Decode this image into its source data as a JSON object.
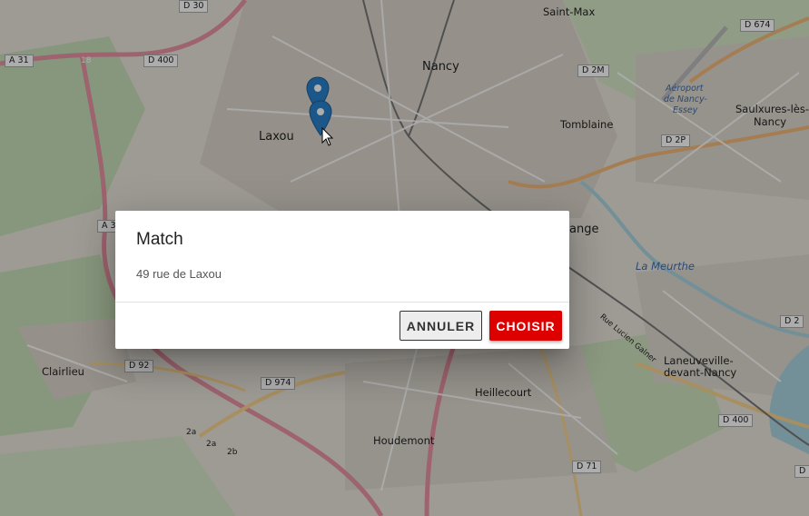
{
  "map": {
    "places": [
      "Saint-Max",
      "Nancy",
      "Laxou",
      "Tomblaine",
      "Aéroport",
      "de Nancy-",
      "Essey",
      "Saulxures-lès-",
      "Nancy",
      "ange",
      "La Meurthe",
      "Clairlieu",
      "Heillecourt",
      "Houdemont",
      "Laneuveville-",
      "devant-Nancy",
      "Rue Lucien Galner"
    ],
    "roads": [
      "D 30",
      "D 674",
      "A 31",
      "D 400",
      "D 2M",
      "D 2P",
      "A 3",
      "D 2",
      "D 92",
      "D 974",
      "D 400",
      "D 71",
      "D"
    ],
    "junctions": [
      "18",
      "2a",
      "2a",
      "2b"
    ],
    "markers": [
      "map-pin",
      "map-pin"
    ]
  },
  "dialog": {
    "title": "Match",
    "address": "49 rue de Laxou",
    "cancel_label": "ANNULER",
    "choose_label": "CHOISIR"
  },
  "colors": {
    "accent": "#dd0000",
    "marker": "#2a81cb"
  }
}
